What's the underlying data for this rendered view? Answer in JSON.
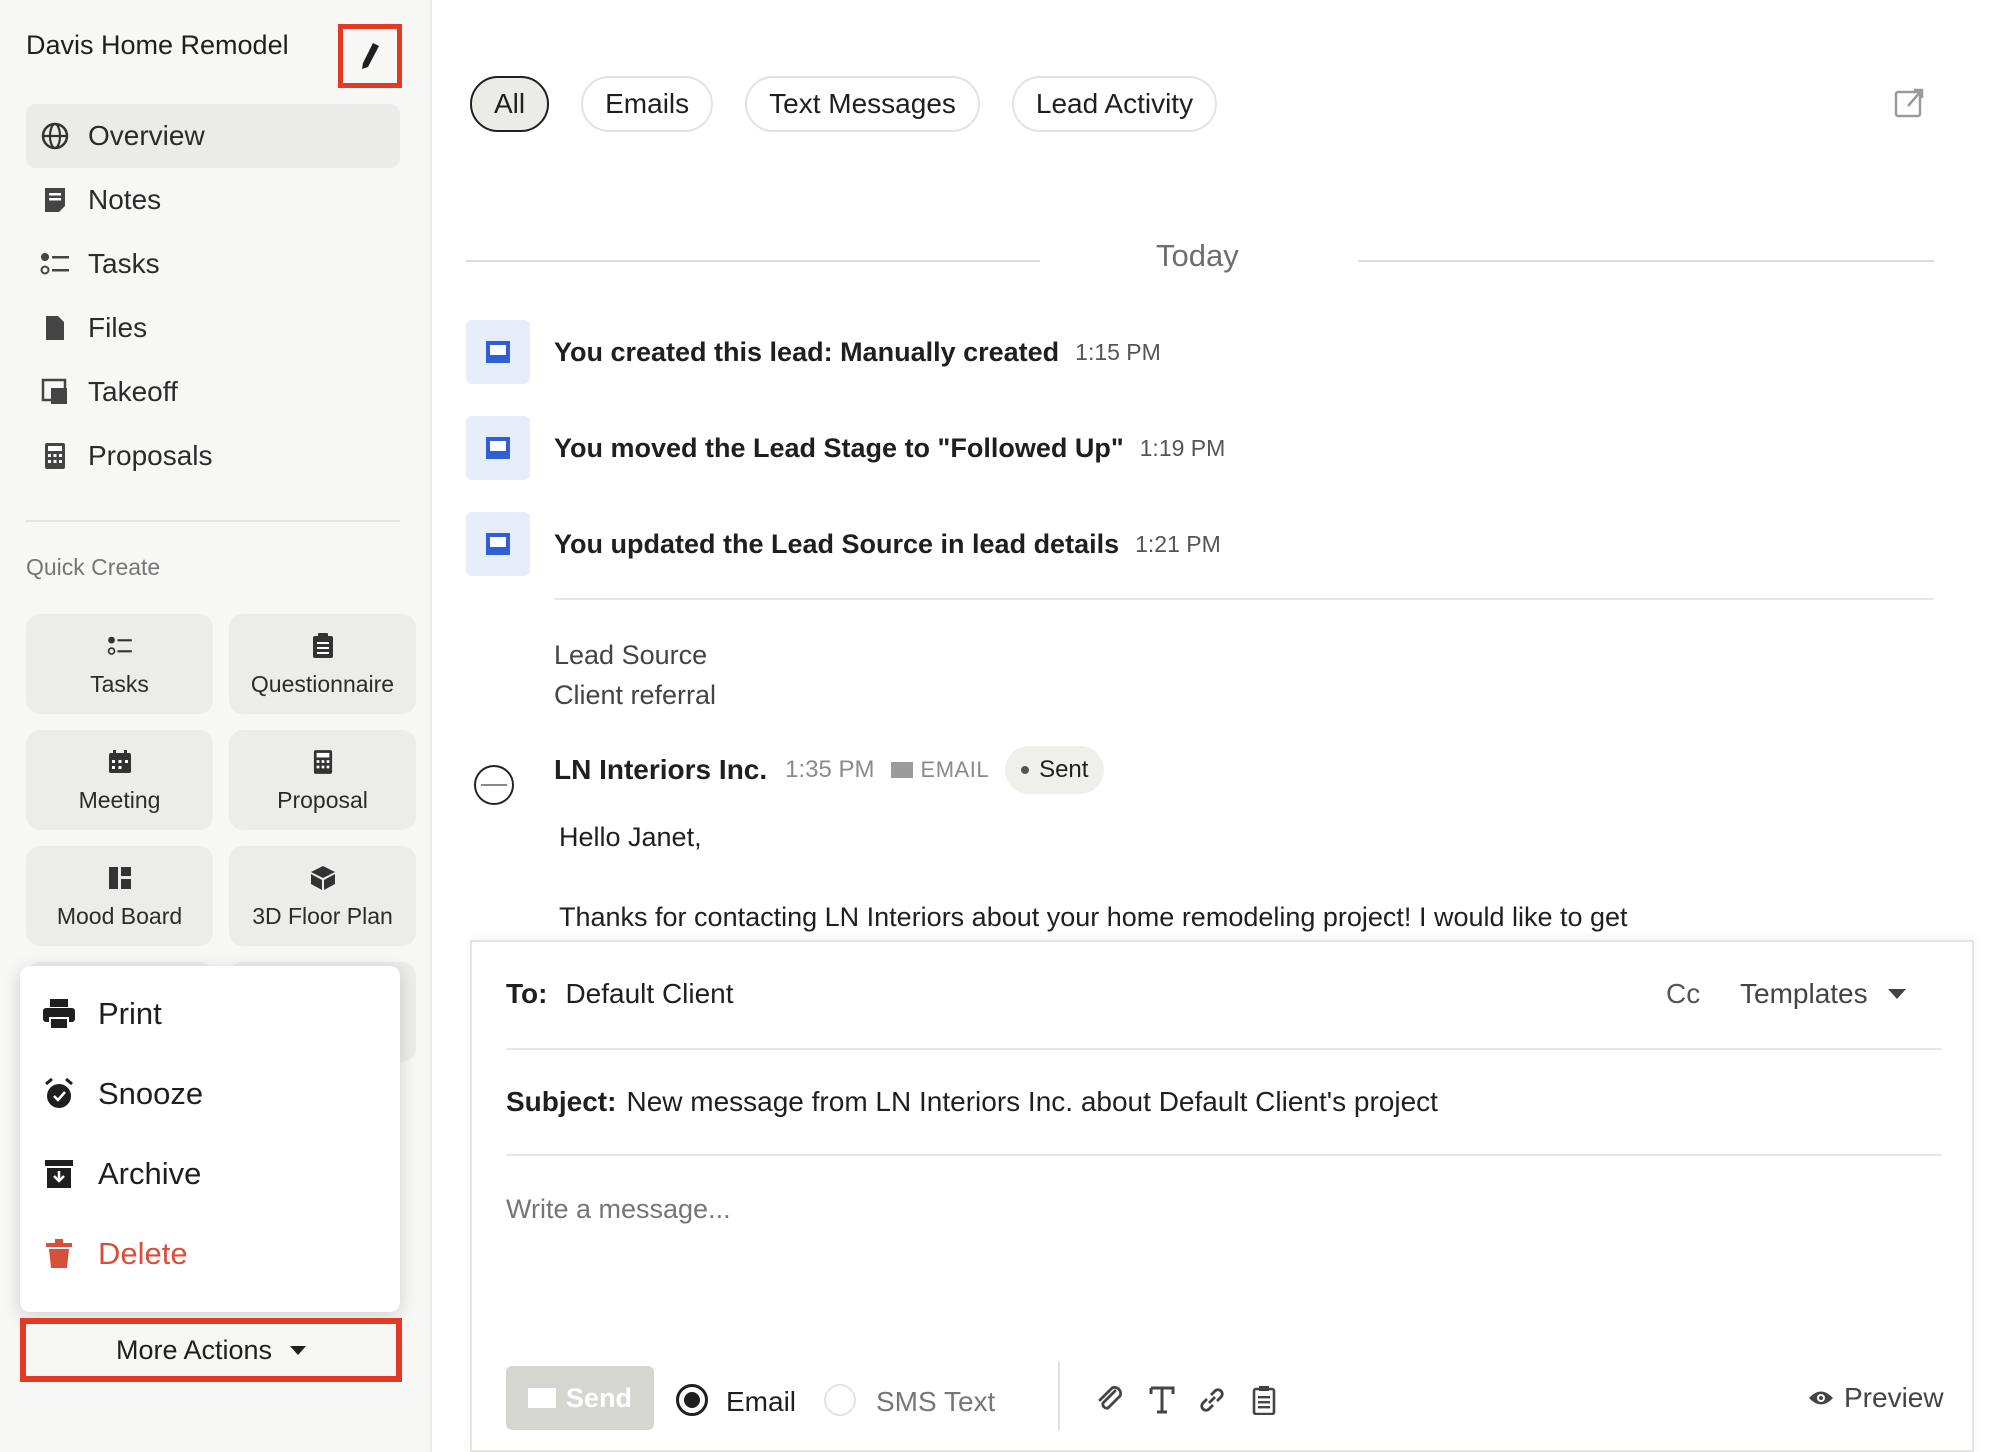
{
  "project": {
    "title": "Davis Home Remodel"
  },
  "nav": {
    "items": [
      {
        "label": "Overview",
        "icon": "globe-icon"
      },
      {
        "label": "Notes",
        "icon": "notes-icon"
      },
      {
        "label": "Tasks",
        "icon": "tasks-icon"
      },
      {
        "label": "Files",
        "icon": "file-icon"
      },
      {
        "label": "Takeoff",
        "icon": "takeoff-icon"
      },
      {
        "label": "Proposals",
        "icon": "calculator-icon"
      }
    ]
  },
  "quick_create": {
    "label": "Quick Create",
    "tiles": [
      {
        "label": "Tasks",
        "icon": "tasks-icon"
      },
      {
        "label": "Questionnaire",
        "icon": "clipboard-icon"
      },
      {
        "label": "Meeting",
        "icon": "calendar-icon"
      },
      {
        "label": "Proposal",
        "icon": "calculator-icon"
      },
      {
        "label": "Mood Board",
        "icon": "moodboard-icon"
      },
      {
        "label": "3D Floor Plan",
        "icon": "cube-icon"
      }
    ]
  },
  "more_actions": {
    "label": "More Actions",
    "items": [
      {
        "label": "Print",
        "icon": "printer-icon"
      },
      {
        "label": "Snooze",
        "icon": "alarm-icon"
      },
      {
        "label": "Archive",
        "icon": "archive-icon"
      },
      {
        "label": "Delete",
        "icon": "trash-icon"
      }
    ]
  },
  "filters": {
    "tabs": [
      "All",
      "Emails",
      "Text Messages",
      "Lead Activity"
    ],
    "active": "All"
  },
  "timeline": {
    "date_label": "Today",
    "activities": [
      {
        "text": "You created this lead: Manually created",
        "time": "1:15 PM"
      },
      {
        "text": "You moved the Lead Stage to \"Followed Up\"",
        "time": "1:19 PM"
      },
      {
        "text": "You updated the Lead Source in lead details",
        "time": "1:21 PM"
      }
    ],
    "lead_source": {
      "label": "Lead Source",
      "value": "Client referral"
    },
    "email": {
      "sender": "LN Interiors Inc.",
      "time": "1:35 PM",
      "type": "EMAIL",
      "status": "Sent",
      "greeting": "Hello Janet,",
      "body_preview": "Thanks for contacting LN Interiors about your home remodeling project! I would like to get"
    }
  },
  "composer": {
    "to_label": "To:",
    "to_value": "Default Client",
    "cc_label": "Cc",
    "templates_label": "Templates",
    "subject_label": "Subject:",
    "subject_value": "New message from LN Interiors Inc. about Default Client's project",
    "message_placeholder": "Write a message...",
    "send_label": "Send",
    "channel_email": "Email",
    "channel_sms": "SMS Text",
    "preview_label": "Preview"
  },
  "colors": {
    "highlight": "#e23a24",
    "danger": "#d9503a",
    "activity_icon_bg": "#e7edf9",
    "activity_icon": "#2f5fd0"
  }
}
